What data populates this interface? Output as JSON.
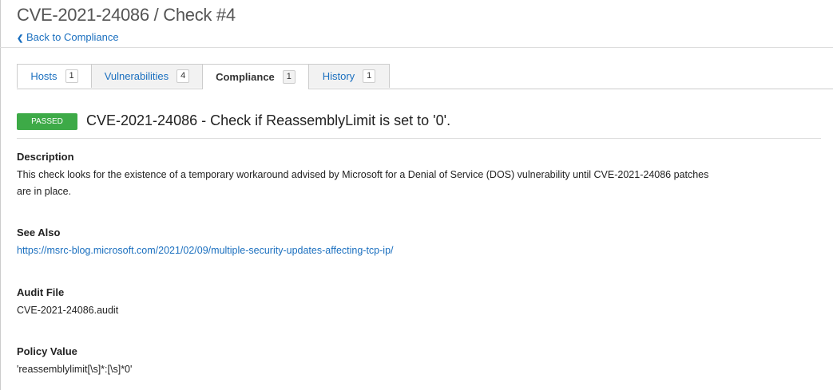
{
  "header": {
    "title": "CVE-2021-24086 / Check #4",
    "back_label": "Back to Compliance"
  },
  "tabs": [
    {
      "label": "Hosts",
      "count": "1"
    },
    {
      "label": "Vulnerabilities",
      "count": "4"
    },
    {
      "label": "Compliance",
      "count": "1",
      "active": true
    },
    {
      "label": "History",
      "count": "1"
    }
  ],
  "check": {
    "status": "PASSED",
    "status_color": "#3daa47",
    "title": "CVE-2021-24086 - Check if ReassemblyLimit is set to '0'."
  },
  "sections": {
    "description": {
      "heading": "Description",
      "text": "This check looks for the existence of a temporary workaround advised by Microsoft for a Denial of Service (DOS) vulnerability until CVE-2021-24086 patches are in place."
    },
    "see_also": {
      "heading": "See Also",
      "link": "https://msrc-blog.microsoft.com/2021/02/09/multiple-security-updates-affecting-tcp-ip/"
    },
    "audit_file": {
      "heading": "Audit File",
      "value": "CVE-2021-24086.audit"
    },
    "policy_value": {
      "heading": "Policy Value",
      "value": "'reassemblylimit[\\s]*:[\\s]*0'"
    }
  }
}
